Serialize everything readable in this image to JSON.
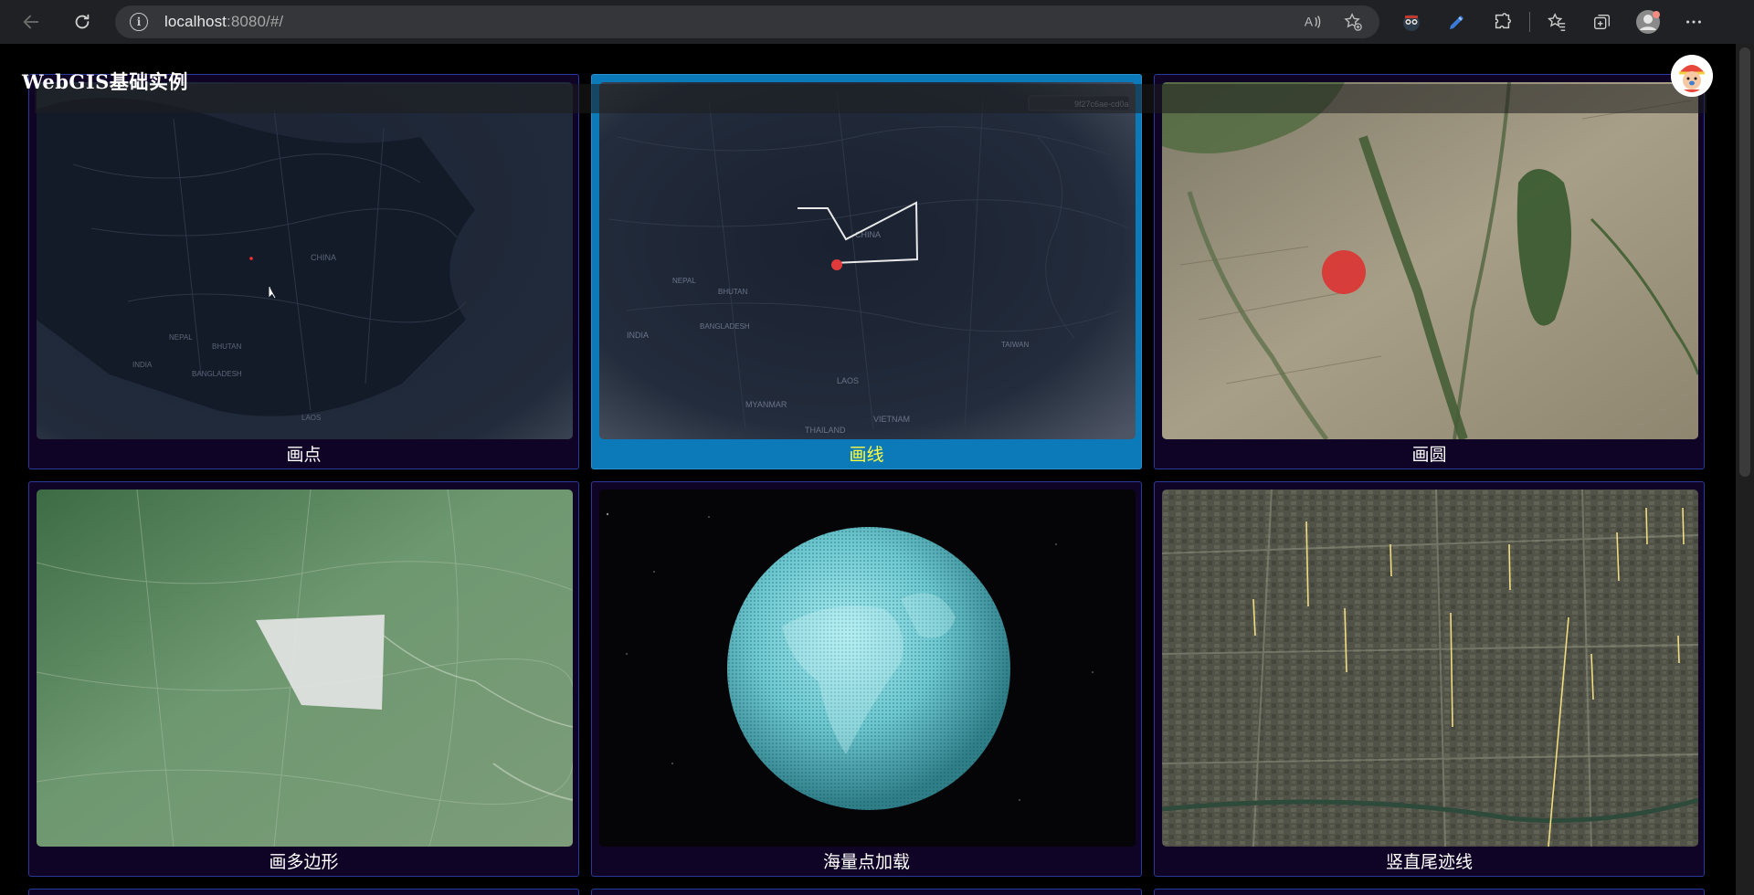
{
  "browser": {
    "url_host": "localhost",
    "url_rest": ":8080/#/",
    "icons": [
      "back-arrow-icon",
      "refresh-icon",
      "info-icon",
      "read-aloud-icon",
      "add-favorite-icon",
      "extension-icon",
      "pen-icon",
      "puzzle-icon",
      "favorites-icon",
      "collections-icon",
      "profile-icon",
      "more-icon"
    ]
  },
  "header": {
    "title": "WebGIS基础实例"
  },
  "cards": [
    {
      "label": "画点",
      "active": false,
      "thumb": "dark-globe-point"
    },
    {
      "label": "画线",
      "active": true,
      "thumb": "dark-map-line"
    },
    {
      "label": "画圆",
      "active": false,
      "thumb": "terrain-circle"
    },
    {
      "label": "画多边形",
      "active": false,
      "thumb": "satellite-polygon"
    },
    {
      "label": "海量点加载",
      "active": false,
      "thumb": "point-sphere"
    },
    {
      "label": "竖直尾迹线",
      "active": false,
      "thumb": "city-trails"
    }
  ],
  "map_labels": {
    "china": "CHINA",
    "india": "INDIA",
    "nepal": "NEPAL",
    "bhutan": "BHUTAN",
    "bangladesh": "BANGLADESH",
    "laos": "LAOS",
    "thailand": "THAILAND",
    "vietnam": "VIETNAM",
    "myanmar": "MYANMAR",
    "taiwan": "TAIWAN",
    "tooltip": "9f27c6ae-cd0a"
  },
  "colors": {
    "active_card": "#0c79b8",
    "card_border": "#2a3a9a",
    "card_bg": "#0f0326",
    "active_caption": "#ffff40"
  }
}
